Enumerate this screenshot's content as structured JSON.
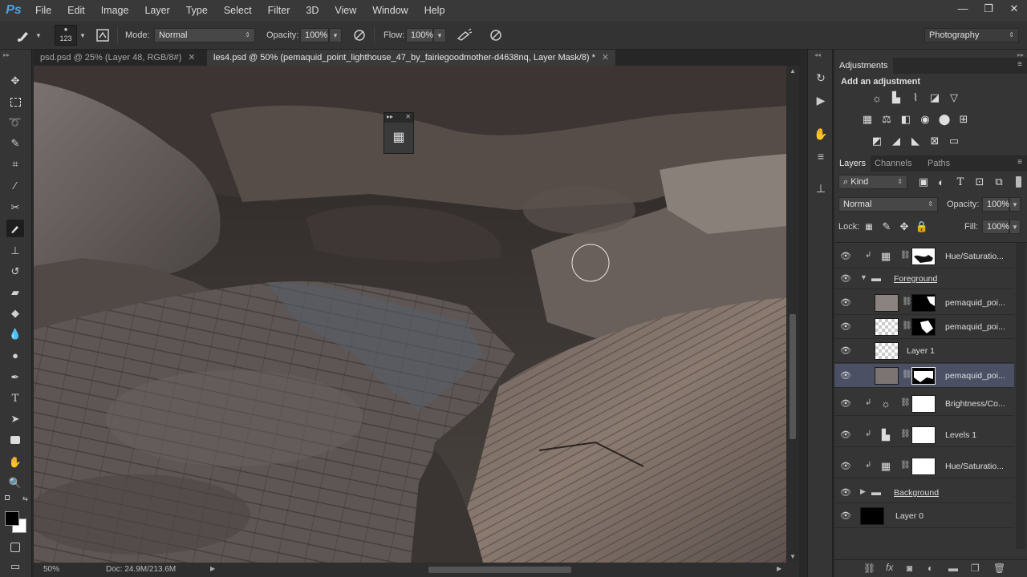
{
  "app": {
    "logo": "Ps"
  },
  "menu": [
    "File",
    "Edit",
    "Image",
    "Layer",
    "Type",
    "Select",
    "Filter",
    "3D",
    "View",
    "Window",
    "Help"
  ],
  "window_controls": {
    "minimize": "—",
    "restore": "❐",
    "close": "✕"
  },
  "options": {
    "brush_size": "123",
    "mode_label": "Mode:",
    "mode_value": "Normal",
    "opacity_label": "Opacity:",
    "opacity_value": "100%",
    "flow_label": "Flow:",
    "flow_value": "100%",
    "workspace": "Photography"
  },
  "tabs": [
    {
      "label": "psd.psd @ 25% (Layer 48, RGB/8#)",
      "close": "✕"
    },
    {
      "label": "les4.psd @ 50% (pemaquid_point_lighthouse_47_by_fairiegoodmother-d4638nq, Layer Mask/8) *",
      "close": "✕"
    }
  ],
  "adjustments": {
    "panel_title": "Adjustments",
    "subtitle": "Add an adjustment"
  },
  "layers_panel": {
    "tabs": [
      "Layers",
      "Channels",
      "Paths"
    ],
    "kind_label": "Kind",
    "blend_mode": "Normal",
    "opacity_label": "Opacity:",
    "opacity_value": "100%",
    "lock_label": "Lock:",
    "fill_label": "Fill:",
    "fill_value": "100%",
    "layers": [
      {
        "name": "Hue/Saturatio..."
      },
      {
        "name": "Foreground"
      },
      {
        "name": "pemaquid_poi..."
      },
      {
        "name": "pemaquid_poi..."
      },
      {
        "name": "Layer 1"
      },
      {
        "name": "pemaquid_poi..."
      },
      {
        "name": "Brightness/Co..."
      },
      {
        "name": "Levels 1"
      },
      {
        "name": "Hue/Saturatio..."
      },
      {
        "name": "Background"
      },
      {
        "name": "Layer 0"
      }
    ]
  },
  "status": {
    "zoom": "50%",
    "doc": "Doc: 24.9M/213.6M"
  }
}
